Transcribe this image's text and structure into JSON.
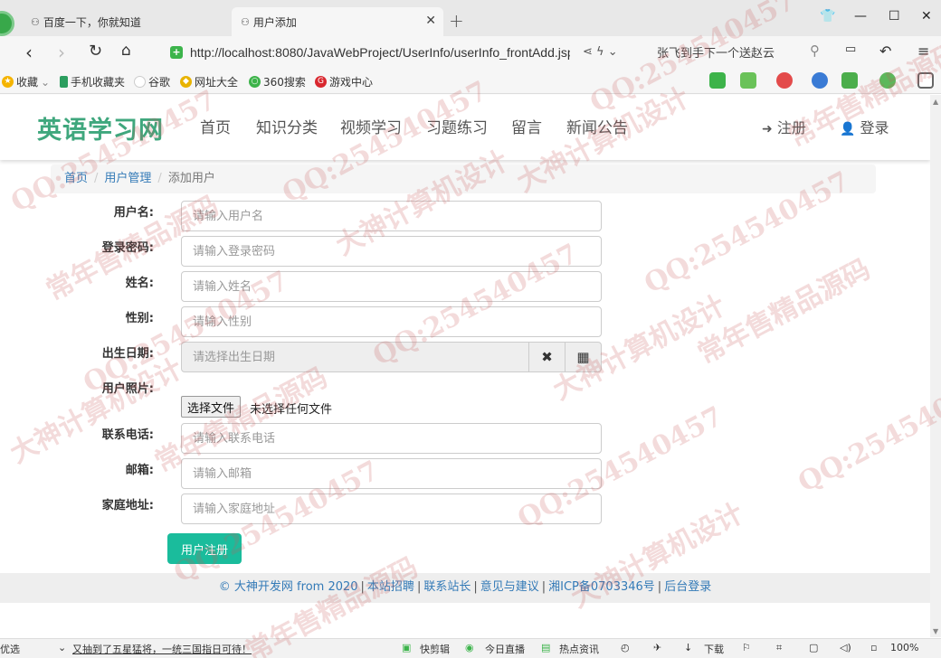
{
  "browser": {
    "tabs": [
      {
        "title": "百度一下，你就知道"
      },
      {
        "title": "用户添加"
      }
    ],
    "url": "http://localhost:8080/JavaWebProject/UserInfo/userInfo_frontAdd.jsp",
    "search_hint": "张飞到手下一个送赵云",
    "bookmarks": [
      "收藏",
      "手机收藏夹",
      "谷歌",
      "网址大全",
      "360搜索",
      "游戏中心"
    ]
  },
  "site": {
    "logo": "英语学习网",
    "menu": [
      "首页",
      "知识分类",
      "视频学习",
      "习题练习",
      "留言",
      "新闻公告"
    ],
    "register": "注册",
    "login": "登录"
  },
  "breadcrumb": {
    "home": "首页",
    "section": "用户管理",
    "current": "添加用户"
  },
  "form": {
    "username": {
      "label": "用户名:",
      "placeholder": "请输入用户名"
    },
    "password": {
      "label": "登录密码:",
      "placeholder": "请输入登录密码"
    },
    "name": {
      "label": "姓名:",
      "placeholder": "请输入姓名"
    },
    "gender": {
      "label": "性别:",
      "placeholder": "请输入性别"
    },
    "birthday": {
      "label": "出生日期:",
      "placeholder": "请选择出生日期"
    },
    "photo": {
      "label": "用户照片:",
      "button": "选择文件",
      "status": "未选择任何文件"
    },
    "phone": {
      "label": "联系电话:",
      "placeholder": "请输入联系电话"
    },
    "email": {
      "label": "邮箱:",
      "placeholder": "请输入邮箱"
    },
    "address": {
      "label": "家庭地址:",
      "placeholder": "请输入家庭地址"
    },
    "submit": "用户注册"
  },
  "footer": {
    "copyright": "© 大神开发网 from 2020",
    "links": [
      "本站招聘",
      "联系站长",
      "意见与建议",
      "湘ICP备0703346号",
      "后台登录"
    ]
  },
  "statusbar": {
    "left": "优选",
    "news": "又抽到了五星猛将，一统三国指日可待！",
    "items": [
      "快剪辑",
      "今日直播",
      "热点资讯",
      "下载"
    ],
    "zoom": "100%"
  },
  "watermarks": [
    "QQ:254540457",
    "大神计算机设计",
    "常年售精品源码"
  ],
  "colors": {
    "brand": "#3fa77d",
    "button": "#1abc9c",
    "link": "#337ab7"
  }
}
